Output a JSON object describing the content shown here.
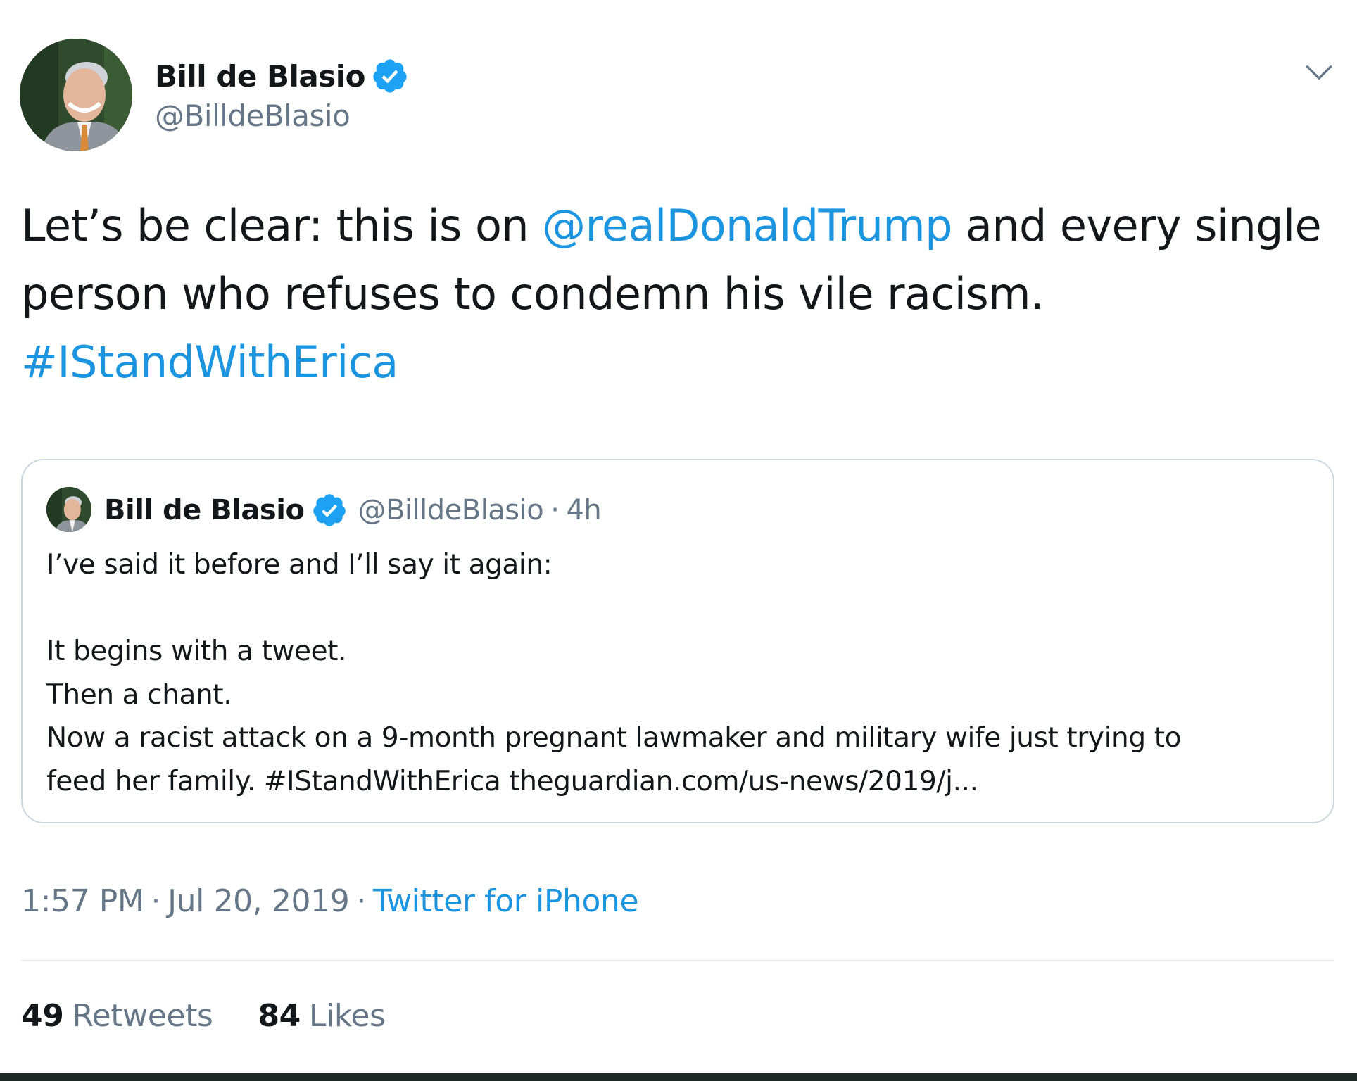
{
  "author": {
    "display_name": "Bill de Blasio",
    "handle": "@BilldeBlasio",
    "avatar_icon": "user-portrait-icon",
    "verified_icon": "verified-badge-icon"
  },
  "menu_icon": "chevron-down-icon",
  "tweet": {
    "text_part1": "Let’s be clear: this is on ",
    "mention": "@realDonaldTrump",
    "text_part2": " and every single person who refuses to condemn his vile racism.",
    "hashtag": "#IStandWithErica"
  },
  "quote": {
    "display_name": "Bill de Blasio",
    "handle": "@BilldeBlasio",
    "separator": "·",
    "time": "4h",
    "lines": [
      "I’ve said it before and I’ll say it again:",
      "",
      "It begins with a tweet.",
      "Then a chant.",
      "Now a racist attack on a 9-month pregnant lawmaker and military wife just trying to",
      "feed her family. #IStandWithErica theguardian.com/us-news/2019/j..."
    ]
  },
  "meta": {
    "time": "1:57 PM",
    "separator": "·",
    "date": "Jul 20, 2019",
    "source": "Twitter for iPhone"
  },
  "stats": {
    "retweets_count": "49",
    "retweets_label": "Retweets",
    "likes_count": "84",
    "likes_label": "Likes"
  },
  "colors": {
    "link": "#1b95e0",
    "secondary_text": "#657786",
    "primary_text": "#14171a",
    "border": "#ccd6dd",
    "verified": "#1da1f2"
  }
}
